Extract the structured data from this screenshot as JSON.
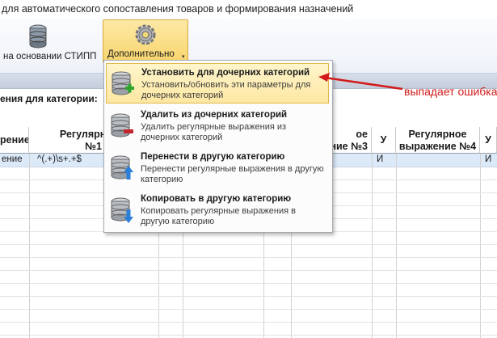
{
  "window": {
    "title": "для автоматического сопоставления товаров и формирования назначений"
  },
  "ribbon": {
    "stipp_label": "на основании СТИПП",
    "more_label": "Дополнительно",
    "more_caret": "▾"
  },
  "main": {
    "section_title": "ения для категории:",
    "error_note": "выпадает ошибка"
  },
  "grid": {
    "headers": {
      "col1": "рение",
      "col2_l1": "Регулярное в",
      "col2_l2": "№1",
      "col3_l1": "ое",
      "col3_l2": "ыражение №3",
      "col4": "У",
      "col5_l1": "Регулярное",
      "col5_l2": "выражение №4",
      "col6": "У"
    },
    "row1": {
      "c1": "ение",
      "c2": "^(.+)\\s+.+$",
      "c4": "И",
      "c6": "И"
    }
  },
  "menu": {
    "items": [
      {
        "title": "Установить для дочерних категорий",
        "desc": "Установить/обновить эти параметры для дочерних категорий",
        "icon": "database-add-icon"
      },
      {
        "title": "Удалить из дочерних категорий",
        "desc": "Удалить регулярные выражения из дочерних категорий",
        "icon": "database-remove-icon"
      },
      {
        "title": "Перенести в другую категорию",
        "desc": "Перенести регулярные выражения в другую категорию",
        "icon": "database-move-icon"
      },
      {
        "title": "Копировать в другую категорию",
        "desc": "Копировать регулярные выражения в другую категорию",
        "icon": "database-copy-icon"
      }
    ]
  },
  "colors": {
    "accent": "#f8d46c",
    "error": "#d21a1a",
    "selection": "#dbe9f8"
  }
}
